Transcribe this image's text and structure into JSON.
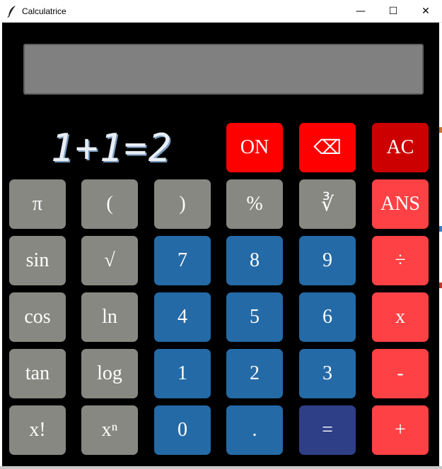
{
  "window": {
    "title": "Calculatrice",
    "icon": "feather-icon",
    "controls": {
      "minimize": "—",
      "maximize": "☐",
      "close": "✕"
    }
  },
  "display": {
    "input": "",
    "result_text": "1+1=2"
  },
  "colors": {
    "background": "#000000",
    "screen": "#808080",
    "function_key": "#888882",
    "digit_key": "#246aa6",
    "equals_key": "#2e3f88",
    "operator_key": "#fd4144",
    "on_key": "#ff0000",
    "ac_key": "#cc0000"
  },
  "keys": {
    "on": "ON",
    "backspace": "⌫",
    "ac": "AC",
    "pi": "π",
    "lparen": "(",
    "rparen": ")",
    "percent": "%",
    "cbrt": "∛",
    "ans": "ANS",
    "sin": "sin",
    "sqrt": "√",
    "seven": "7",
    "eight": "8",
    "nine": "9",
    "divide": "÷",
    "cos": "cos",
    "ln": "ln",
    "four": "4",
    "five": "5",
    "six": "6",
    "multiply": "x",
    "tan": "tan",
    "log": "log",
    "one": "1",
    "two": "2",
    "three": "3",
    "minus": "-",
    "factorial": "x!",
    "power": "xⁿ",
    "zero": "0",
    "dot": ".",
    "equals": "=",
    "plus": "+"
  }
}
